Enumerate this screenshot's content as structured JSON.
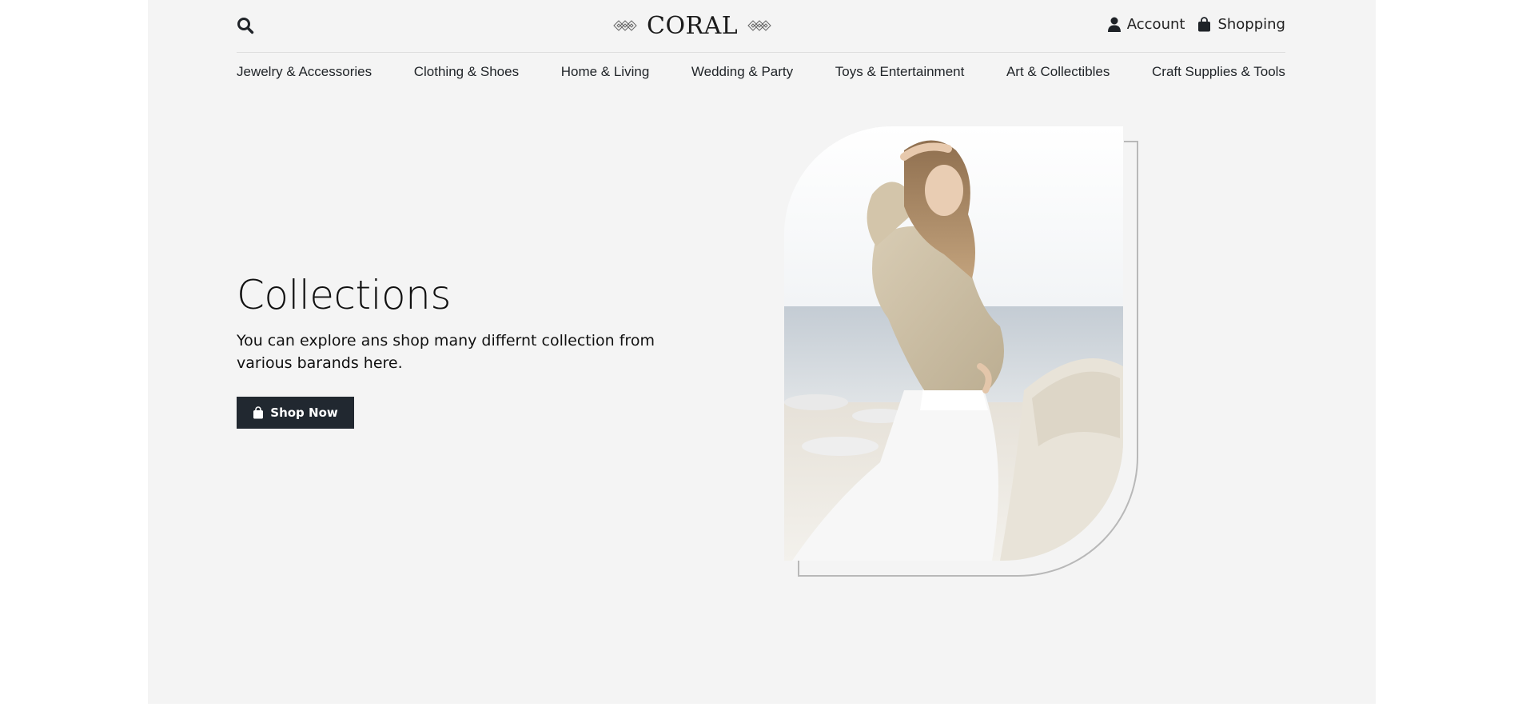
{
  "header": {
    "logo_text": "CORAL",
    "account_label": "Account",
    "shopping_label": "Shopping"
  },
  "nav": {
    "items": [
      "Jewelry & Accessories",
      "Clothing & Shoes",
      "Home & Living",
      "Wedding & Party",
      "Toys & Entertainment",
      "Art & Collectibles",
      "Craft Supplies & Tools"
    ]
  },
  "hero": {
    "title": "Collections",
    "description": "You can explore ans shop many differnt collection from various barands here.",
    "cta_label": "Shop Now"
  },
  "icons": {
    "search": "search-icon",
    "account": "user-icon",
    "shopping": "shopping-bag-icon",
    "logo_ornament": "diamond-ornament-icon"
  },
  "colors": {
    "page_background": "#f4f4f4",
    "button_background": "#212830",
    "text": "#111111"
  }
}
